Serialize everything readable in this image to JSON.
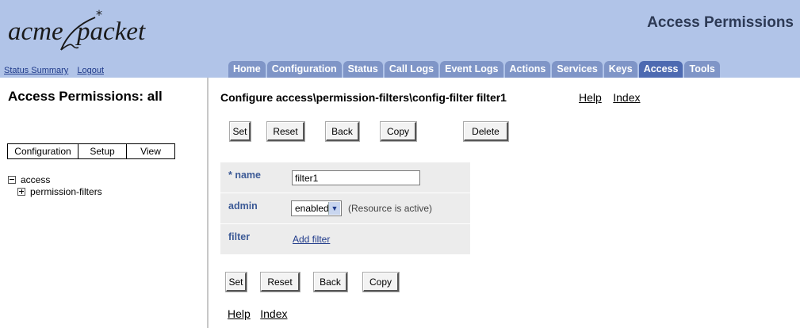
{
  "header": {
    "logo_left": "acme",
    "logo_right": "packet",
    "page_heading": "Access Permissions",
    "links": [
      "Status Summary",
      "Logout"
    ],
    "tabs": [
      "Home",
      "Configuration",
      "Status",
      "Call Logs",
      "Event Logs",
      "Actions",
      "Services",
      "Keys",
      "Access",
      "Tools"
    ],
    "active_tab": "Access"
  },
  "sidebar": {
    "title": "Access Permissions: all",
    "view_buttons": [
      "Configuration",
      "Setup",
      "View"
    ],
    "tree": {
      "root": "access",
      "child": "permission-filters"
    }
  },
  "main": {
    "title": "Configure access\\permission-filters\\config-filter filter1",
    "help_label": "Help",
    "index_label": "Index",
    "buttons_top": {
      "set": "Set",
      "reset": "Reset",
      "back": "Back",
      "copy": "Copy",
      "delete": "Delete"
    },
    "buttons_bottom": {
      "set": "Set",
      "reset": "Reset",
      "back": "Back",
      "copy": "Copy"
    },
    "form": {
      "name_label": "* name",
      "name_value": "filter1",
      "admin_label": "admin",
      "admin_value": "enabled",
      "admin_note": "(Resource is active)",
      "filter_label": "filter",
      "add_filter_label": "Add filter"
    }
  },
  "colors": {
    "header_bg": "#b1c4e8",
    "tab_bg": "#7f95c7",
    "tab_active_bg": "#4d6ab1",
    "label_color": "#3c5a96",
    "link_color": "#1f3a8a"
  },
  "icons": {
    "tree_collapse": "minus-box-icon",
    "tree_expand": "plus-box-icon",
    "dropdown": "chevron-down-icon"
  }
}
